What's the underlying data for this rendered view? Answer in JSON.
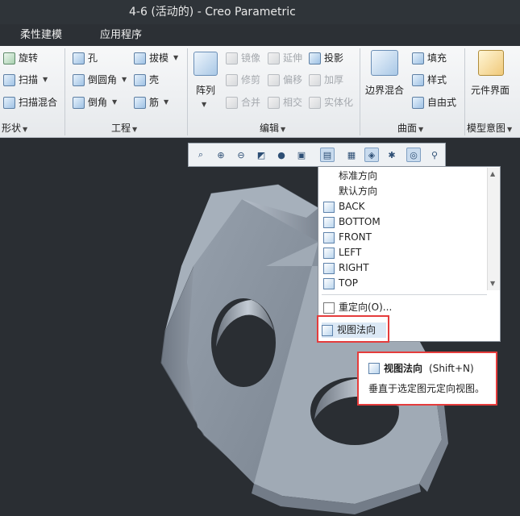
{
  "window": {
    "title": "4-6 (活动的) - Creo Parametric"
  },
  "menu": {
    "items": [
      "柔性建模",
      "应用程序"
    ]
  },
  "ribbon": {
    "shape": {
      "revolve": "旋转",
      "sweep": "扫描",
      "swept_blend": "扫描混合",
      "label": "形状"
    },
    "engineering": {
      "hole": "孔",
      "round": "倒圆角",
      "chamfer": "倒角",
      "draft": "拔模",
      "shell": "壳",
      "rib": "筋",
      "label": "工程"
    },
    "editing": {
      "pattern": "阵列",
      "mirror": "镜像",
      "extend": "延伸",
      "project": "投影",
      "trim": "修剪",
      "offset": "偏移",
      "thicken": "加厚",
      "merge": "合并",
      "intersect": "相交",
      "solidify": "实体化",
      "label": "编辑"
    },
    "surfaces": {
      "boundary_blend": "边界混合",
      "fill": "填充",
      "style": "样式",
      "freestyle": "自由式",
      "label": "曲面"
    },
    "model_intent": {
      "component_interface": "元件界面",
      "label": "模型意图"
    }
  },
  "view_toolbar": {
    "icons": [
      "refit-icon",
      "zoom-in-icon",
      "zoom-out-icon",
      "repaint-icon",
      "display-style-icon",
      "saved-views-icon",
      "view-normal-icon",
      "view-manager-icon",
      "layers-icon",
      "datum-display-icon",
      "spin-center-icon",
      "annotation-icon"
    ]
  },
  "orientation_menu": {
    "items": [
      {
        "label": "标准方向",
        "icon": ""
      },
      {
        "label": "默认方向",
        "icon": ""
      },
      {
        "label": "BACK",
        "icon": "cube-icon"
      },
      {
        "label": "BOTTOM",
        "icon": "cube-icon"
      },
      {
        "label": "FRONT",
        "icon": "cube-icon"
      },
      {
        "label": "LEFT",
        "icon": "cube-icon"
      },
      {
        "label": "RIGHT",
        "icon": "cube-icon"
      },
      {
        "label": "TOP",
        "icon": "cube-icon"
      }
    ],
    "reorient": "重定向(O)...",
    "view_normal": "视图法向"
  },
  "tooltip": {
    "title": "视图法向",
    "shortcut": "(Shift+N)",
    "description": "垂直于选定图元定向视图。"
  },
  "colors": {
    "title_bg": "#2f3439",
    "model": "#8e98a4",
    "highlight": "#e53c3c",
    "selection": "#c9dbee"
  }
}
